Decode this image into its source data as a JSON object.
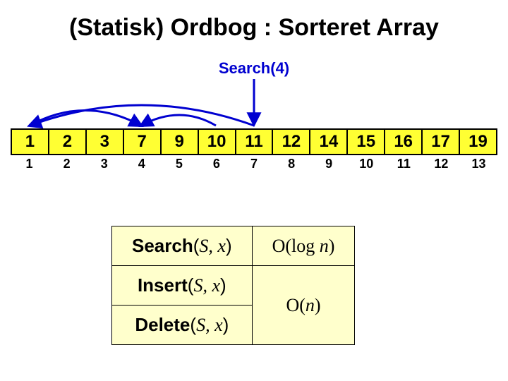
{
  "title": "(Statisk) Ordbog : Sorteret Array",
  "search_label": "Search(4)",
  "array": {
    "values": [
      "1",
      "2",
      "3",
      "7",
      "9",
      "10",
      "11",
      "12",
      "14",
      "15",
      "16",
      "17",
      "19"
    ],
    "indices": [
      "1",
      "2",
      "3",
      "4",
      "5",
      "6",
      "7",
      "8",
      "9",
      "10",
      "11",
      "12",
      "13"
    ]
  },
  "complexity": {
    "ops": {
      "search": {
        "name": "Search",
        "args": "S, x"
      },
      "insert": {
        "name": "Insert",
        "args": "S, x"
      },
      "delete": {
        "name": "Delete",
        "args": "S, x"
      }
    },
    "search_big_o": "O(log ",
    "search_var": "n",
    "search_close": ")",
    "linear_big_o": "O(",
    "linear_var": "n",
    "linear_close": ")"
  },
  "chart_data": {
    "type": "table",
    "title": "(Statisk) Ordbog : Sorteret Array",
    "sorted_array_values": [
      1,
      2,
      3,
      7,
      9,
      10,
      11,
      12,
      14,
      15,
      16,
      17,
      19
    ],
    "indices": [
      1,
      2,
      3,
      4,
      5,
      6,
      7,
      8,
      9,
      10,
      11,
      12,
      13
    ],
    "binary_search_target": 4,
    "binary_search_probe_indices": [
      7,
      4
    ],
    "binary_search_range_narrowing": [
      [
        1,
        13
      ],
      [
        1,
        6
      ],
      [
        4,
        6
      ]
    ],
    "complexity_rows": [
      {
        "operation": "Search(S, x)",
        "complexity": "O(log n)"
      },
      {
        "operation": "Insert(S, x)",
        "complexity": "O(n)"
      },
      {
        "operation": "Delete(S, x)",
        "complexity": "O(n)"
      }
    ]
  }
}
